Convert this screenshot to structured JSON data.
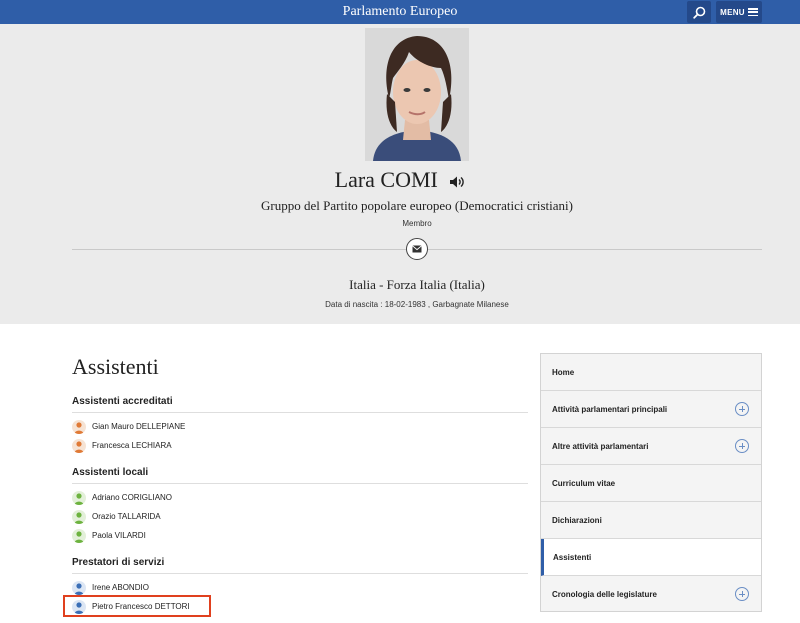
{
  "app": {
    "title": "Parlamento Europeo",
    "menu_label": "MENU"
  },
  "icons": {
    "search": "search-icon",
    "menu": "hamburger-icon",
    "speaker": "speaker-icon",
    "mail": "envelope-icon",
    "expand": "plus-circle-icon",
    "person": "person-icon"
  },
  "colors": {
    "brand": "#2f5ea8",
    "accredited": "#e07a36",
    "local": "#6db33f",
    "services": "#3b6fb6",
    "highlight": "#e0401e"
  },
  "profile": {
    "name": "Lara COMI",
    "group": "Gruppo del Partito popolare europeo (Democratici cristiani)",
    "role": "Membro",
    "country_party": "Italia - Forza Italia (Italia)",
    "birth": "Data di nascita : 18-02-1983 , Garbagnate Milanese"
  },
  "main": {
    "title": "Assistenti",
    "sections": [
      {
        "title": "Assistenti accreditati",
        "kind": "accredited",
        "people": [
          "Gian Mauro DELLEPIANE",
          "Francesca LECHIARA"
        ]
      },
      {
        "title": "Assistenti locali",
        "kind": "local",
        "people": [
          "Adriano CORIGLIANO",
          "Orazio TALLARIDA",
          "Paola VILARDI"
        ]
      },
      {
        "title": "Prestatori di servizi",
        "kind": "services",
        "people": [
          "Irene ABONDIO",
          "Pietro Francesco DETTORI"
        ]
      }
    ]
  },
  "sidebar": {
    "items": [
      {
        "label": "Home",
        "expandable": false,
        "active": false
      },
      {
        "label": "Attività parlamentari principali",
        "expandable": true,
        "active": false
      },
      {
        "label": "Altre attività parlamentari",
        "expandable": true,
        "active": false
      },
      {
        "label": "Curriculum vitae",
        "expandable": false,
        "active": false
      },
      {
        "label": "Dichiarazioni",
        "expandable": false,
        "active": false
      },
      {
        "label": "Assistenti",
        "expandable": false,
        "active": true
      },
      {
        "label": "Cronologia delle legislature",
        "expandable": true,
        "active": false
      }
    ]
  }
}
